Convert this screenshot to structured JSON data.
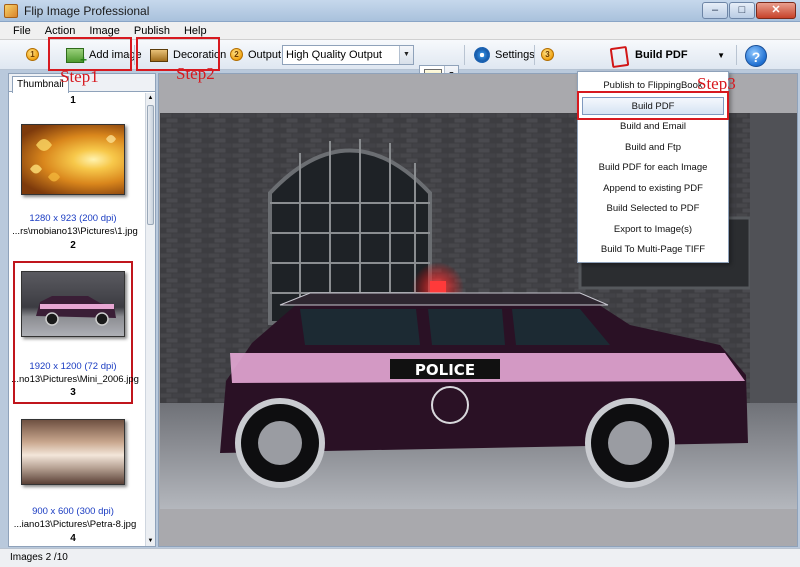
{
  "window": {
    "title": "Flip Image Professional",
    "minimize": "‒",
    "maximize": "□",
    "close": "✕"
  },
  "menu": [
    "File",
    "Action",
    "Image",
    "Publish",
    "Help"
  ],
  "toolbar": {
    "step_numbers": [
      "1",
      "2",
      "3"
    ],
    "add_image": "Add image",
    "decoration": "Decoration",
    "output_label": "Output:",
    "output_value": "High Quality Output",
    "settings": "Settings",
    "build_pdf": "Build PDF",
    "help": "?"
  },
  "left_panel": {
    "tab": "Thumbnail",
    "thumbnails": [
      {
        "num": "1",
        "size": "",
        "path": ""
      },
      {
        "num": "2",
        "size": "1280 x 923 (200 dpi)",
        "path": "...rs\\mobiano13\\Pictures\\1.jpg"
      },
      {
        "num": "3",
        "size": "1920 x 1200 (72 dpi)",
        "path": "...no13\\Pictures\\Mini_2006.jpg"
      },
      {
        "num": "4",
        "size": "900 x 600 (300 dpi)",
        "path": "...iano13\\Pictures\\Petra-8.jpg"
      }
    ]
  },
  "photo": {
    "sign_text": "POLICE"
  },
  "build_menu": {
    "items": [
      "Publish to FlippingBook",
      "Build PDF",
      "Build and Email",
      "Build and Ftp",
      "Build PDF for each Image",
      "Append to existing PDF",
      "Build Selected to PDF",
      "Export to Image(s)",
      "Build To Multi-Page TIFF"
    ],
    "highlighted_index": 1
  },
  "annotations": {
    "step1": "Step1",
    "step2": "Step2",
    "step3": "Step3"
  },
  "status": {
    "text": "Images 2 /10"
  }
}
